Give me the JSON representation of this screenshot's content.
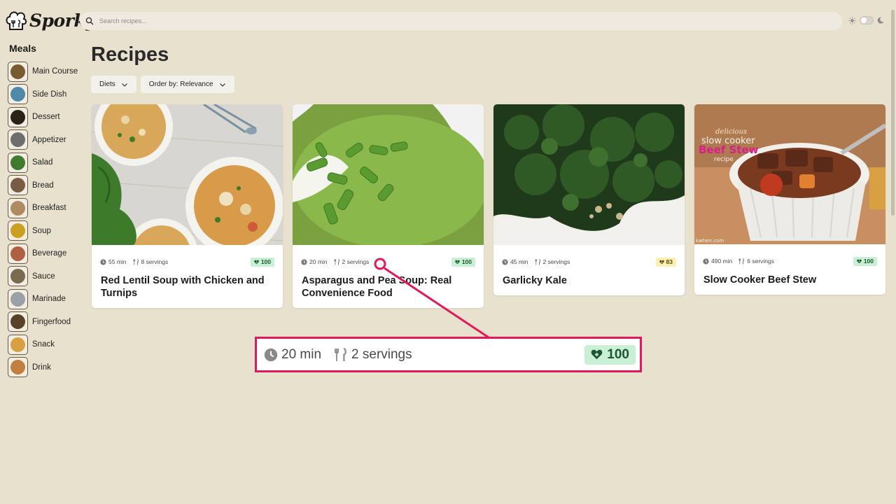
{
  "app": {
    "name": "Sporky"
  },
  "search": {
    "placeholder": "Search recipes..."
  },
  "sidebar": {
    "title": "Meals",
    "items": [
      {
        "label": "Main Course",
        "icon": "main-course-thumb",
        "color": "#7a5a30"
      },
      {
        "label": "Side Dish",
        "icon": "side-dish-thumb",
        "color": "#4f89a8"
      },
      {
        "label": "Dessert",
        "icon": "dessert-thumb",
        "color": "#2a2418"
      },
      {
        "label": "Appetizer",
        "icon": "appetizer-thumb",
        "color": "#6e6e6e"
      },
      {
        "label": "Salad",
        "icon": "salad-thumb",
        "color": "#3f7a2f"
      },
      {
        "label": "Bread",
        "icon": "bread-thumb",
        "color": "#7a5c44"
      },
      {
        "label": "Breakfast",
        "icon": "breakfast-thumb",
        "color": "#b08a60"
      },
      {
        "label": "Soup",
        "icon": "soup-thumb",
        "color": "#c9a020"
      },
      {
        "label": "Beverage",
        "icon": "beverage-thumb",
        "color": "#b06040"
      },
      {
        "label": "Sauce",
        "icon": "sauce-thumb",
        "color": "#7a6a50"
      },
      {
        "label": "Marinade",
        "icon": "marinade-thumb",
        "color": "#9aa0a8"
      },
      {
        "label": "Fingerfood",
        "icon": "fingerfood-thumb",
        "color": "#5a4028"
      },
      {
        "label": "Snack",
        "icon": "snack-thumb",
        "color": "#d8a040"
      },
      {
        "label": "Drink",
        "icon": "drink-thumb",
        "color": "#c08040"
      }
    ]
  },
  "main": {
    "title": "Recipes",
    "filters": [
      {
        "label": "Diets"
      },
      {
        "label": "Order by: Relevance"
      }
    ],
    "recipes": [
      {
        "title": "Red Lentil Soup with Chicken and Turnips",
        "time": "55 min",
        "servings": "8 servings",
        "score": "100",
        "score_color": "green"
      },
      {
        "title": "Asparagus and Pea Soup: Real Convenience Food",
        "time": "20 min",
        "servings": "2 servings",
        "score": "100",
        "score_color": "green"
      },
      {
        "title": "Garlicky Kale",
        "time": "45 min",
        "servings": "2 servings",
        "score": "83",
        "score_color": "yellow"
      },
      {
        "title": "Slow Cooker Beef Stew",
        "time": "490 min",
        "servings": "6 servings",
        "score": "100",
        "score_color": "green"
      }
    ],
    "image_text": {
      "stew_line1": "delicious",
      "stew_line2": "slow cooker",
      "stew_line3": "Beef Stew",
      "stew_line4": "recipe",
      "stew_credit": "kwhen.com"
    }
  },
  "callout": {
    "time": "20 min",
    "servings": "2 servings",
    "score": "100"
  },
  "colors": {
    "background": "#e8e1cd",
    "accent": "#e0195a",
    "score_green": "#c9f0d4",
    "score_yellow": "#fdf0b5"
  }
}
